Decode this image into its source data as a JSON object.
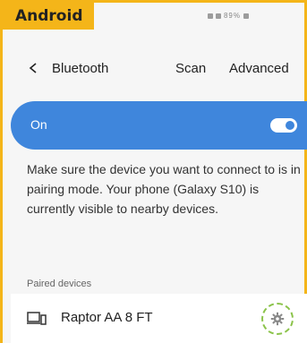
{
  "os_tag": "Android",
  "status_bar": {
    "battery": "89%"
  },
  "header": {
    "title": "Bluetooth",
    "scan_label": "Scan",
    "advanced_label": "Advanced",
    "back_icon": "chevron-left-icon"
  },
  "toggle": {
    "label": "On",
    "state": true,
    "accent": "#3f86dc"
  },
  "description": "Make sure the device you want to connect to is in pairing mode. Your phone (Galaxy S10) is currently visible to nearby devices.",
  "paired": {
    "header": "Paired devices",
    "devices": [
      {
        "name": "Raptor AA 8 FT",
        "icon": "devices-icon",
        "action_icon": "gear-icon"
      }
    ]
  },
  "colors": {
    "frame": "#f4b519",
    "highlight": "#8bc34a"
  }
}
